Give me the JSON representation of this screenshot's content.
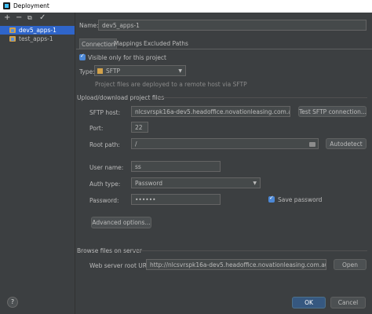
{
  "window": {
    "title": "Deployment"
  },
  "toolbar": {
    "add": "+",
    "remove": "−",
    "copy": "⧉",
    "apply": "✓"
  },
  "tree": {
    "items": [
      {
        "label": "dev5_apps-1"
      },
      {
        "label": "test_apps-1"
      }
    ]
  },
  "name": {
    "label": "Name:",
    "value": "dev5_apps-1"
  },
  "tabs": [
    {
      "label": "Connection"
    },
    {
      "label": "Mappings"
    },
    {
      "label": "Excluded Paths"
    }
  ],
  "visible_only": {
    "label": "Visible only for this project",
    "checked": true
  },
  "type": {
    "label": "Type:",
    "value": "SFTP",
    "hint": "Project files are deployed to a remote host via SFTP"
  },
  "upload_section": {
    "title": "Upload/download project files"
  },
  "sftp_host": {
    "label": "SFTP host:",
    "value": "nlcsvrspk16a-dev5.headoffice.novationleasing.com.au",
    "test_button": "Test SFTP connection..."
  },
  "port": {
    "label": "Port:",
    "value": "22"
  },
  "root_path": {
    "label": "Root path:",
    "value": "/",
    "autodetect_button": "Autodetect"
  },
  "user_name": {
    "label": "User name:",
    "value": "ss"
  },
  "auth_type": {
    "label": "Auth type:",
    "value": "Password"
  },
  "password": {
    "label": "Password:",
    "value": "••••••",
    "save_label": "Save password",
    "save_checked": true
  },
  "advanced_button": "Advanced options...",
  "browse_section": {
    "title": "Browse files on server"
  },
  "web_root": {
    "label": "Web server root URL:",
    "value": "http://nlcsvrspk16a-dev5.headoffice.novationleasing.com.au",
    "open_button": "Open"
  },
  "footer": {
    "help": "?",
    "ok": "OK",
    "cancel": "Cancel"
  },
  "colors": {
    "background": "#3c3f41",
    "selection": "#2f65ca",
    "primary_button": "#365880",
    "text": "#bbbbbb"
  }
}
